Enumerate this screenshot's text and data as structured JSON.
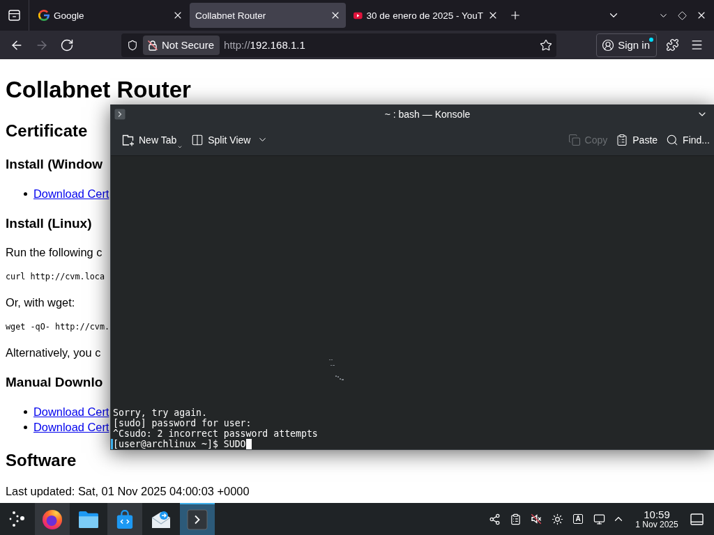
{
  "browser": {
    "tabs": [
      {
        "kind": "google",
        "title": "Google",
        "selected": false
      },
      {
        "kind": "plain",
        "title": "Collabnet Router",
        "selected": true
      },
      {
        "kind": "youtube",
        "title": "30 de enero de 2025 - YouT",
        "selected": false
      }
    ],
    "nav": [
      {
        "kind": "back",
        "disabled": false
      },
      {
        "kind": "forward",
        "disabled": true
      },
      {
        "kind": "reload",
        "disabled": false
      }
    ],
    "address": {
      "security": "Not Secure",
      "scheme": "http://",
      "host": "192.168.1.1"
    },
    "sign_in": {
      "label": "Sign in",
      "notification": true
    }
  },
  "page": {
    "blocks": [
      {
        "kind": "h1",
        "text": "Collabnet Router"
      },
      {
        "kind": "h2",
        "text": "Certificate"
      },
      {
        "kind": "h3",
        "text": "Install (Window"
      },
      {
        "kind": "list",
        "items": [
          "Download Cert"
        ]
      },
      {
        "kind": "h3",
        "text": "Install (Linux)"
      },
      {
        "kind": "p",
        "text": "Run the following c"
      },
      {
        "kind": "code",
        "text": "curl http://cvm.loca"
      },
      {
        "kind": "p",
        "text": "Or, with wget:"
      },
      {
        "kind": "code",
        "text": "wget -qO- http://cvm."
      },
      {
        "kind": "p",
        "text": "Alternatively, you c"
      },
      {
        "kind": "h3",
        "text": "Manual Downlo"
      },
      {
        "kind": "list",
        "items": [
          "Download Cert",
          "Download Cert"
        ]
      },
      {
        "kind": "h2",
        "text": "Software"
      },
      {
        "kind": "p",
        "text": "Last updated: Sat, 01 Nov 2025 04:00:03 +0000"
      }
    ]
  },
  "konsole": {
    "title": "~ : bash — Konsole",
    "toolbar_left": [
      {
        "kind": "new-tab",
        "label": "New Tab",
        "disabled": false
      },
      {
        "kind": "split-view",
        "label": "Split View",
        "disabled": false
      }
    ],
    "toolbar_right": [
      {
        "kind": "copy",
        "label": "Copy",
        "disabled": true
      },
      {
        "kind": "paste",
        "label": "Paste",
        "disabled": false
      },
      {
        "kind": "find",
        "label": "Find...",
        "disabled": false
      }
    ],
    "lines": [
      "Sorry, try again.",
      "[sudo] password for user:",
      "^Csudo: 2 incorrect password attempts"
    ],
    "prompt": "[user@archlinux ~]$ ",
    "input": "SUDO"
  },
  "taskbar": {
    "apps": [
      {
        "kind": "firefox",
        "running": true,
        "selected": false
      },
      {
        "kind": "files",
        "running": false,
        "selected": false
      },
      {
        "kind": "discover",
        "running": true,
        "selected": false
      },
      {
        "kind": "mail",
        "running": false,
        "selected": false
      },
      {
        "kind": "konsole",
        "running": true,
        "selected": true
      }
    ],
    "keyboard_layout": "A",
    "clock": {
      "time": "10:59",
      "date": "1 Nov 2025"
    }
  }
}
